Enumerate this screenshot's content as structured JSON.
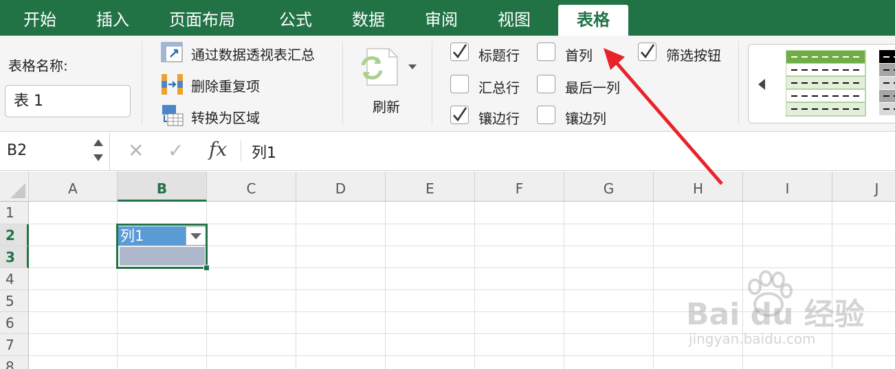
{
  "tabs": [
    "开始",
    "插入",
    "页面布局",
    "公式",
    "数据",
    "审阅",
    "视图",
    "表格"
  ],
  "active_tab": "表格",
  "ribbon": {
    "table_name_label": "表格名称:",
    "table_name_value": "表 1",
    "tools": [
      "通过数据透视表汇总",
      "删除重复项",
      "转换为区域"
    ],
    "refresh_label": "刷新",
    "options": [
      {
        "label": "标题行",
        "checked": true
      },
      {
        "label": "汇总行",
        "checked": false
      },
      {
        "label": "镶边行",
        "checked": true
      },
      {
        "label": "首列",
        "checked": false
      },
      {
        "label": "最后一列",
        "checked": false
      },
      {
        "label": "镶边列",
        "checked": false
      },
      {
        "label": "筛选按钮",
        "checked": true
      }
    ]
  },
  "formula_bar": {
    "cell_ref": "B2",
    "cancel": "✕",
    "confirm": "✓",
    "fx": "fx",
    "value": "列1"
  },
  "grid": {
    "columns": [
      "A",
      "B",
      "C",
      "D",
      "E",
      "F",
      "G",
      "H",
      "I",
      "J"
    ],
    "rows": [
      "1",
      "2",
      "3",
      "4",
      "5",
      "6",
      "7",
      "8"
    ],
    "selected_column": "B",
    "selected_rows": [
      "2",
      "3"
    ],
    "table_header": "列1"
  },
  "watermark": {
    "text": "Bai du 经验",
    "sub": "jingyan.baidu.com"
  },
  "colors": {
    "excel_green": "#217346",
    "table_header": "#5b9bd5",
    "table_row": "#adb9ca",
    "arrow": "#e8232a"
  }
}
